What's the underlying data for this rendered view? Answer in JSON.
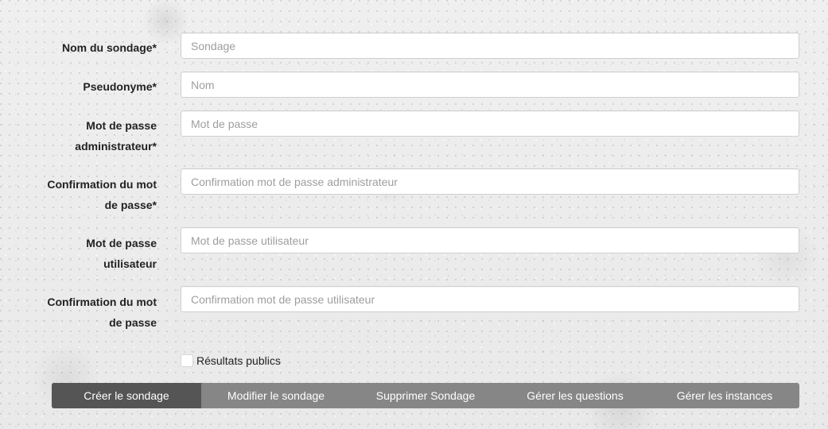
{
  "form": {
    "survey_name": {
      "label": "Nom du sondage*",
      "placeholder": "Sondage",
      "value": ""
    },
    "pseudonym": {
      "label": "Pseudonyme*",
      "placeholder": "Nom",
      "value": ""
    },
    "admin_password": {
      "label_line1": "Mot de passe",
      "label_line2": "administrateur*",
      "placeholder": "Mot de passe",
      "value": ""
    },
    "admin_password_confirm": {
      "label_line1": "Confirmation du mot",
      "label_line2": "de passe*",
      "placeholder": "Confirmation mot de passe administrateur",
      "value": ""
    },
    "user_password": {
      "label_line1": "Mot de passe",
      "label_line2": "utilisateur",
      "placeholder": "Mot de passe utilisateur",
      "value": ""
    },
    "user_password_confirm": {
      "label_line1": "Confirmation du mot",
      "label_line2": "de passe",
      "placeholder": "Confirmation mot de passe utilisateur",
      "value": ""
    },
    "public_results": {
      "label": "Résultats publics",
      "checked": false
    }
  },
  "nav": {
    "items": [
      {
        "label": "Créer le sondage",
        "active": true
      },
      {
        "label": "Modifier le sondage",
        "active": false
      },
      {
        "label": "Supprimer Sondage",
        "active": false
      },
      {
        "label": "Gérer les questions",
        "active": false
      },
      {
        "label": "Gérer les instances",
        "active": false
      }
    ]
  },
  "colors": {
    "nav_background": "#868686",
    "nav_active": "#555555",
    "nav_text": "#ffffff",
    "placeholder": "#9e9e9e",
    "label_text": "#222222"
  }
}
